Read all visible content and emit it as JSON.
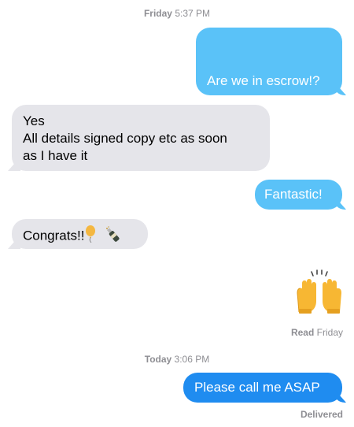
{
  "conversation": {
    "timestamp1": {
      "day": "Friday",
      "time": "5:37 PM"
    },
    "timestamp2": {
      "day": "Today",
      "time": "3:06 PM"
    },
    "messages": [
      {
        "text": "Are we in escrow!?"
      },
      {
        "lines": [
          "Yes",
          "All details signed copy etc as soon",
          "as I have it"
        ]
      },
      {
        "text": "Fantastic!"
      },
      {
        "text": "Congrats!!"
      },
      {
        "emoji": "raising-hands-emoji"
      },
      {
        "text": "Please call me ASAP"
      }
    ],
    "read_status": {
      "label": "Read",
      "day": "Friday"
    },
    "delivered_status": "Delivered"
  },
  "colors": {
    "outgoing_light": "#5ac2f8",
    "outgoing_dark": "#1f8cf0",
    "incoming": "#e5e5ea",
    "meta_text": "#8e8e93"
  }
}
